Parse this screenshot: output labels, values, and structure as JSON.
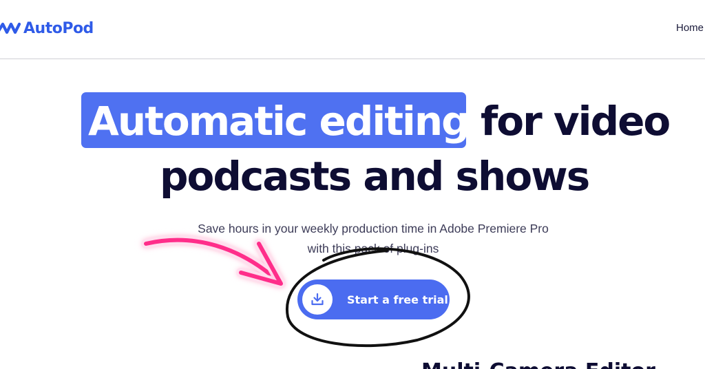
{
  "header": {
    "logo_text": "AutoPod",
    "nav": {
      "home_label": "Home"
    }
  },
  "hero": {
    "headline_highlight": "Automatic editing",
    "headline_rest": "for video",
    "headline_line2": "podcasts and shows",
    "subtitle_line1": "Save hours in your weekly production time in Adobe Premiere Pro",
    "subtitle_line2": "with this pack of plug-ins",
    "cta_label": "Start a free trial",
    "cta_icon": "download-icon"
  },
  "below_fold": {
    "partial_heading": "Multi-Camera Editor"
  },
  "annotations": {
    "arrow": "pink-arrow",
    "circle": "hand-drawn-circle"
  },
  "colors": {
    "brand_blue": "#2f5be8",
    "highlight_blue": "#4f71f1",
    "cta_blue": "#4b6cf0",
    "heading_dark": "#0e0d33",
    "annotation_pink": "#ff2d8a"
  }
}
